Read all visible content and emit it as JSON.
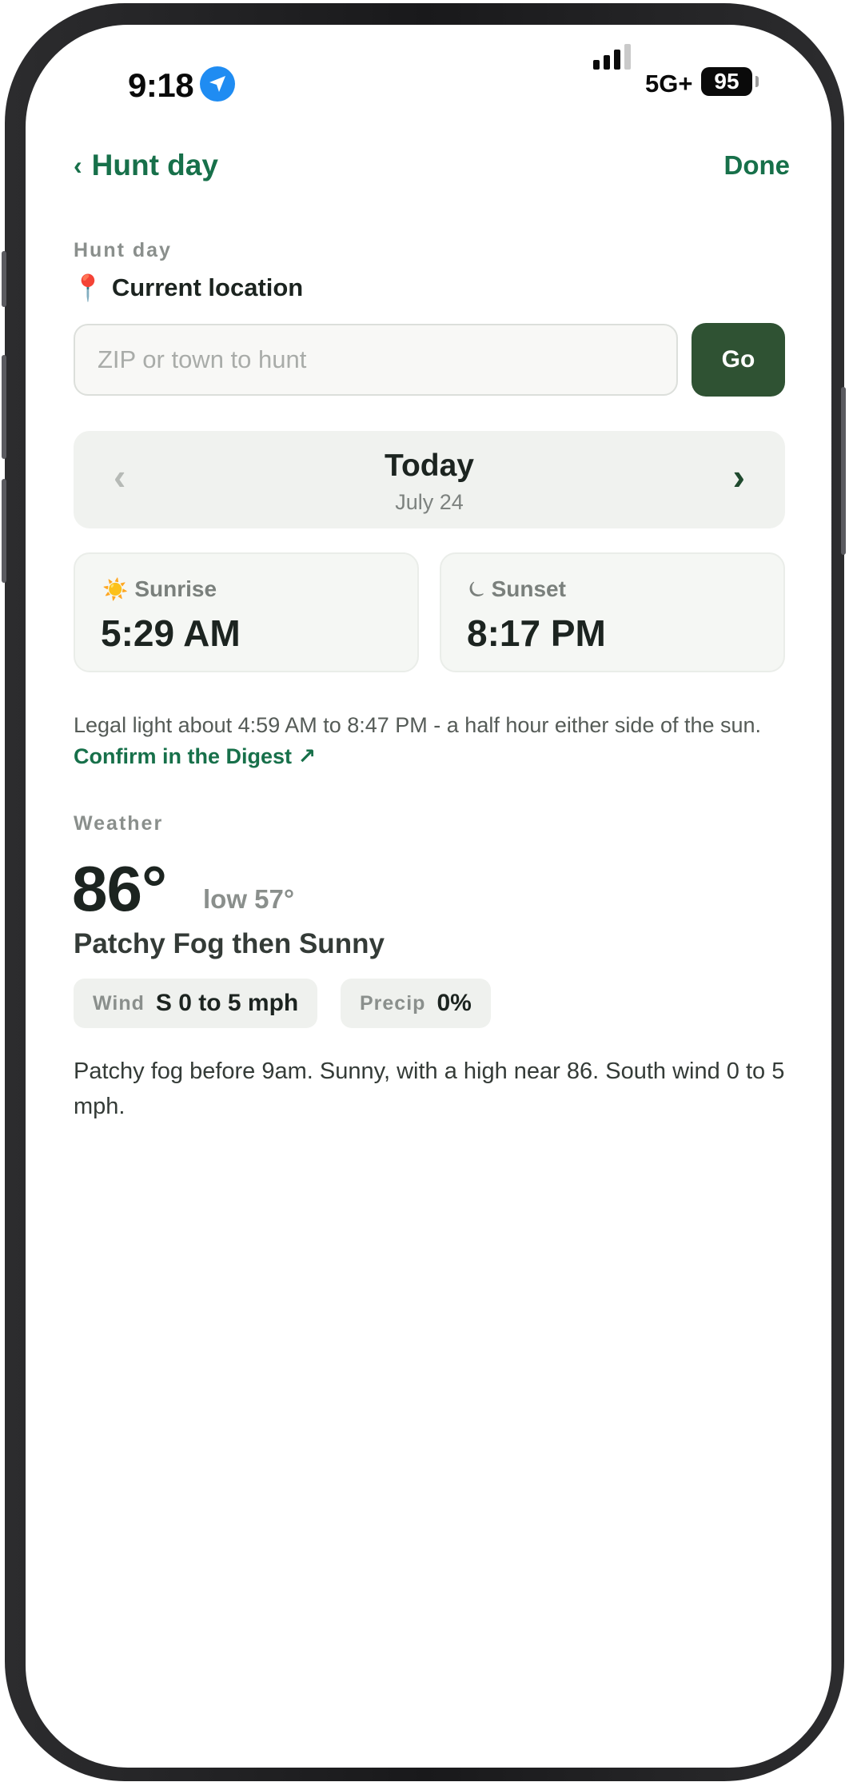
{
  "status_bar": {
    "time": "9:18",
    "network": "5G+",
    "battery": "95"
  },
  "nav": {
    "back_label": "Hunt day",
    "back_chevron": "‹",
    "done_label": "Done"
  },
  "hunt_day": {
    "section_label": "Hunt day",
    "location_icon": "📍",
    "current_location": "Current location",
    "search_placeholder": "ZIP or town to hunt",
    "search_value": "",
    "go_label": "Go"
  },
  "day_picker": {
    "prev_chevron": "‹",
    "next_chevron": "›",
    "title": "Today",
    "date": "July 24"
  },
  "sun": {
    "sunrise_icon": "☀️",
    "sunrise_label": "Sunrise",
    "sunrise_value": "5:29 AM",
    "sunset_icon": "⏾",
    "sunset_label": "Sunset",
    "sunset_value": "8:17 PM"
  },
  "legal": {
    "text": "Legal light about 4:59 AM to 8:47 PM - a half hour either side of the sun.",
    "link_label": "Confirm in the Digest ↗"
  },
  "weather": {
    "section_label": "Weather",
    "high": "86°",
    "low": "low 57°",
    "condition": "Patchy Fog then Sunny",
    "wind_label": "Wind",
    "wind_value": "S 0 to 5 mph",
    "precip_label": "Precip",
    "precip_value": "0%",
    "forecast": "Patchy fog before 9am. Sunny, with a high near 86. South wind 0 to 5 mph."
  },
  "colors": {
    "accent_green": "#17704a",
    "button_green": "#2f5233",
    "location_blue": "#1f8cf2"
  }
}
